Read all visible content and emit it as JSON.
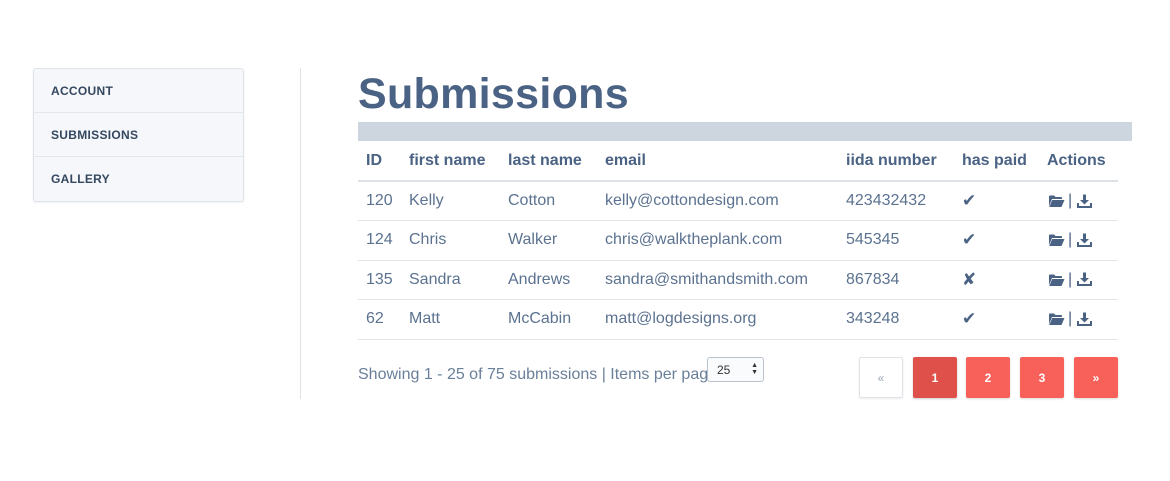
{
  "sidebar": {
    "items": [
      {
        "label": "ACCOUNT"
      },
      {
        "label": "SUBMISSIONS"
      },
      {
        "label": "GALLERY"
      }
    ]
  },
  "page": {
    "title": "Submissions"
  },
  "table": {
    "headers": [
      "ID",
      "first name",
      "last name",
      "email",
      "iida number",
      "has paid",
      "Actions"
    ],
    "rows": [
      {
        "id": "120",
        "first": "Kelly",
        "last": "Cotton",
        "email": "kelly@cottondesign.com",
        "iida": "423432432",
        "paid": "✔",
        "paid_icon": "check-icon"
      },
      {
        "id": "124",
        "first": "Chris",
        "last": "Walker",
        "email": "chris@walktheplank.com",
        "iida": "545345",
        "paid": "✔",
        "paid_icon": "check-icon"
      },
      {
        "id": "135",
        "first": "Sandra",
        "last": "Andrews",
        "email": "sandra@smithandsmith.com",
        "iida": "867834",
        "paid": "✘",
        "paid_icon": "cross-icon"
      },
      {
        "id": "62",
        "first": "Matt",
        "last": "McCabin",
        "email": "matt@logdesigns.org",
        "iida": "343248",
        "paid": "✔",
        "paid_icon": "check-icon"
      }
    ],
    "action_icons": [
      "folder-open-icon",
      "download-icon"
    ],
    "action_separator": "|"
  },
  "footer": {
    "showing_text": "Showing 1 - 25 of 75 submissions | Items per page",
    "per_page_value": "25"
  },
  "pagination": {
    "prev": "«",
    "pages": [
      "1",
      "2",
      "3"
    ],
    "next": "»",
    "current": "1"
  },
  "colors": {
    "text": "#4a6283",
    "active_page": "#e0504a",
    "page": "#f8605a",
    "title_bar": "#cdd5df"
  }
}
